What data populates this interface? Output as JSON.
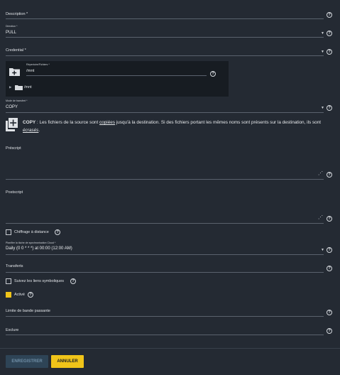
{
  "fields": {
    "description": {
      "label": "Description *"
    },
    "direction": {
      "label": "Direction *",
      "value": "PULL"
    },
    "credential": {
      "label": "Credential *"
    },
    "transfer_mode": {
      "label": "Mode de transfert *",
      "value": "COPY"
    },
    "prescript": {
      "label": "Préscript"
    },
    "postscript": {
      "label": "Postscript"
    },
    "schedule": {
      "label": "Planifier la tâche de synchronisation Cloud *",
      "value": "Daily (0 0 * * *) at 00:00 (12:00 AM)"
    },
    "transfers": {
      "label": "Transferts"
    },
    "bandwidth": {
      "label": "Limite de bande passante"
    },
    "exclude": {
      "label": "Exclure"
    }
  },
  "explorer": {
    "label": "Répertoire/Fichiers *",
    "value": "/mnt",
    "tree_item": "/mnt"
  },
  "copy_info": {
    "title": "COPY",
    "text_part1": " : Les fichiers de la source sont ",
    "word_copied": "copiées",
    "text_part2": " jusqu'à la destination. Si des fichiers portant les mêmes noms sont présents sur la destination, ils sont ",
    "word_overwritten": "écrasés",
    "text_part3": "."
  },
  "checkboxes": {
    "remote_encryption": {
      "label": "Chiffrage à distance",
      "checked": false
    },
    "follow_symlinks": {
      "label": "Suivez les liens symboliques",
      "checked": false
    },
    "enabled": {
      "label": "Activé",
      "checked": true
    }
  },
  "buttons": {
    "save": "ENREGISTRER",
    "cancel": "ANNULER"
  },
  "colors": {
    "background": "#242a33",
    "accent": "#f0c419",
    "explorer_bg": "#171c22"
  }
}
